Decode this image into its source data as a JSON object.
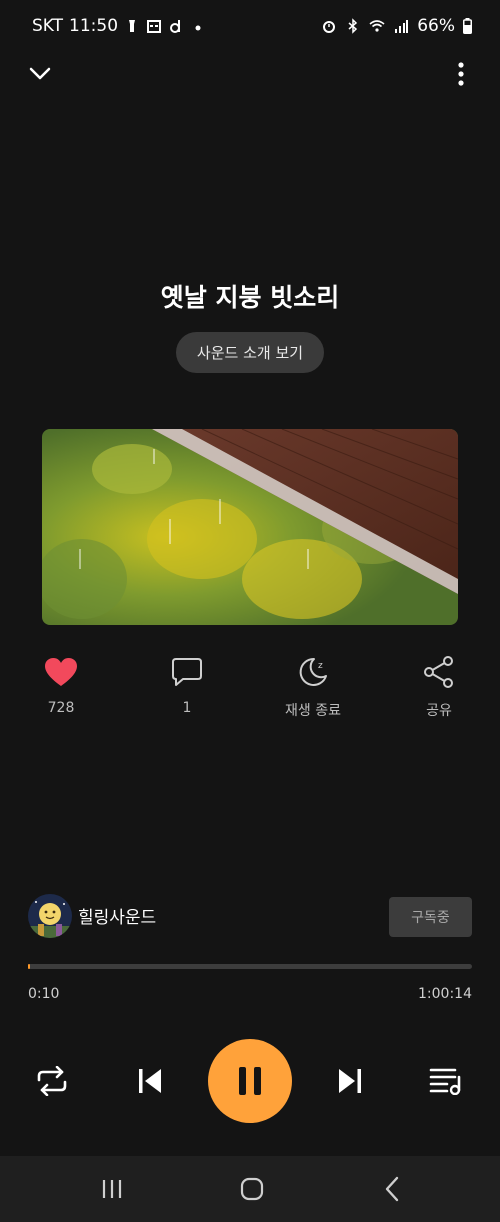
{
  "status_bar": {
    "carrier": "SKT",
    "time": "11:50",
    "battery": "66%"
  },
  "sound": {
    "title": "옛날 지붕 빗소리",
    "intro_button": "사운드 소개 보기"
  },
  "actions": {
    "like_count": "728",
    "comment_count": "1",
    "sleep_label": "재생 종료",
    "share_label": "공유"
  },
  "channel": {
    "name": "힐링사운드",
    "subscribe_label": "구독중"
  },
  "player": {
    "current_time": "0:10",
    "total_time": "1:00:14",
    "progress_fraction": 0.003,
    "accent_color": "#ffa23a",
    "like_color": "#f2495c"
  },
  "icons": {
    "collapse": "chevron-down-icon",
    "more": "more-vertical-icon",
    "like": "heart-icon",
    "comment": "comment-icon",
    "sleep": "moon-icon",
    "share": "share-icon",
    "repeat": "repeat-icon",
    "previous": "skip-previous-icon",
    "pause": "pause-icon",
    "next": "skip-next-icon",
    "playlist": "playlist-icon"
  }
}
